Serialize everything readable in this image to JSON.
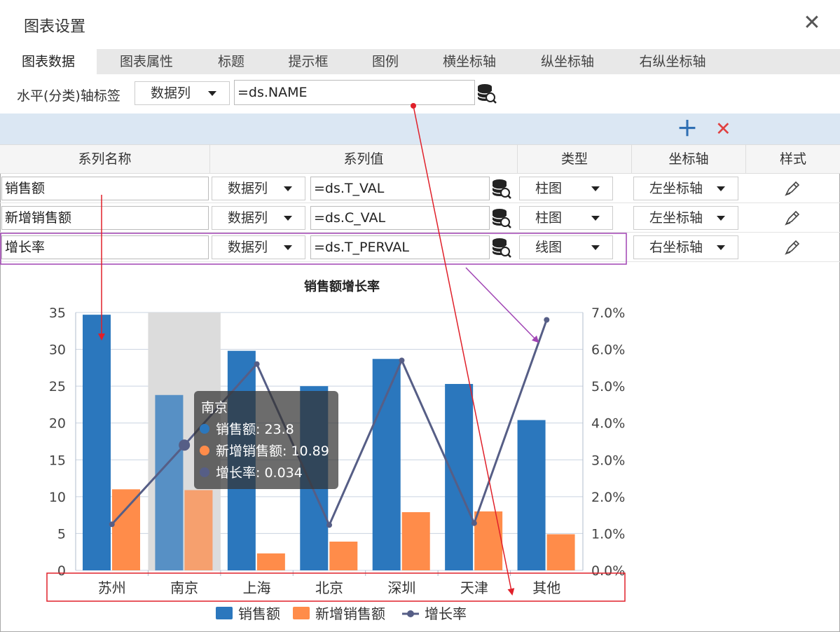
{
  "dialog": {
    "title": "图表设置",
    "close_icon": "close-icon"
  },
  "tabs": [
    "图表数据",
    "图表属性",
    "标题",
    "提示框",
    "图例",
    "横坐标轴",
    "纵坐标轴",
    "右纵坐标轴"
  ],
  "category_axis": {
    "label": "水平(分类)轴标签",
    "source": "数据列",
    "expression": "=ds.NAME"
  },
  "toolbar": {
    "add_icon": "plus-icon",
    "delete_icon": "delete-x-icon"
  },
  "grid": {
    "headers": [
      "系列名称",
      "系列值",
      "类型",
      "坐标轴",
      "样式"
    ],
    "rows": [
      {
        "name": "销售额",
        "source": "数据列",
        "value": "=ds.T_VAL",
        "type": "柱图",
        "axis": "左坐标轴"
      },
      {
        "name": "新增销售额",
        "source": "数据列",
        "value": "=ds.C_VAL",
        "type": "柱图",
        "axis": "左坐标轴"
      },
      {
        "name": "增长率",
        "source": "数据列",
        "value": "=ds.T_PERVAL",
        "type": "线图",
        "axis": "右坐标轴"
      }
    ]
  },
  "tooltip": {
    "title": "南京",
    "lines": [
      "销售额: 23.8",
      "新增销售额: 10.89",
      "增长率: 0.034"
    ]
  },
  "colors": {
    "bar1": "#2b77bd",
    "bar2": "#ff8c4a",
    "line": "#565e86",
    "accent": "#2f6fb3",
    "annot_red": "#e0202a",
    "annot_purple": "#a044b4"
  },
  "chart_data": {
    "type": "bar",
    "title": "销售额增长率",
    "categories": [
      "苏州",
      "南京",
      "上海",
      "北京",
      "深圳",
      "天津",
      "其他"
    ],
    "series": [
      {
        "name": "销售额",
        "type": "bar",
        "axis": "left",
        "values": [
          34.7,
          23.8,
          29.8,
          25.0,
          28.7,
          25.3,
          20.4
        ]
      },
      {
        "name": "新增销售额",
        "type": "bar",
        "axis": "left",
        "values": [
          11.0,
          10.89,
          2.3,
          3.9,
          7.9,
          8.0,
          4.9
        ]
      },
      {
        "name": "增长率",
        "type": "line",
        "axis": "right",
        "values": [
          0.0125,
          0.034,
          0.056,
          0.0123,
          0.057,
          0.0128,
          0.068
        ]
      }
    ],
    "left_axis": {
      "range": [
        0,
        35
      ],
      "ticks": [
        "0",
        "5",
        "10",
        "15",
        "20",
        "25",
        "30",
        "35"
      ]
    },
    "right_axis": {
      "range": [
        0,
        0.07
      ],
      "ticks": [
        "0.0%",
        "1.0%",
        "2.0%",
        "3.0%",
        "4.0%",
        "5.0%",
        "6.0%",
        "7.0%"
      ]
    },
    "highlighted_category": "南京",
    "grid": true,
    "legend": "bottom"
  }
}
